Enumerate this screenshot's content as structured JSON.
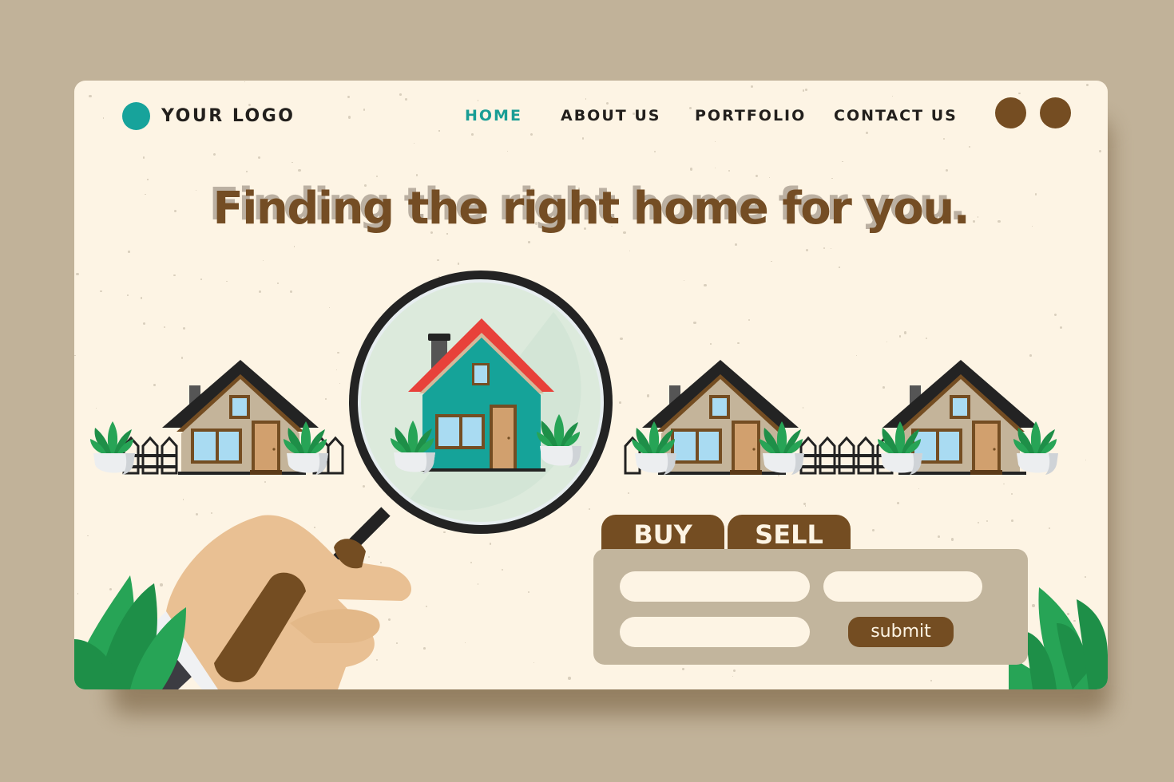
{
  "colors": {
    "background": "#c1b299",
    "page": "#fdf4e4",
    "brand_teal": "#17a39b",
    "nav_active": "#199d95",
    "brown": "#744d22",
    "headline_shadow": "#bbb0a2",
    "panel": "#c2b59d",
    "house_wall": "#c4b49a",
    "house_roof": "#232323",
    "featured_wall": "#15a399",
    "featured_roof": "#e8413a",
    "plant_green": "#27a456",
    "skin": "#e9c093"
  },
  "header": {
    "logo_text": "YOUR LOGO",
    "nav": [
      {
        "label": "HOME",
        "active": true
      },
      {
        "label": "ABOUT US",
        "active": false
      },
      {
        "label": "PORTFOLIO",
        "active": false
      },
      {
        "label": "CONTACT US",
        "active": false
      }
    ],
    "header_buttons": [
      "circle-button",
      "circle-button"
    ]
  },
  "hero": {
    "headline": "Finding the right home for you."
  },
  "search": {
    "tabs": [
      {
        "label": "BUY"
      },
      {
        "label": "SELL"
      }
    ],
    "fields": [
      {
        "value": "",
        "placeholder": ""
      },
      {
        "value": "",
        "placeholder": ""
      },
      {
        "value": "",
        "placeholder": ""
      }
    ],
    "submit_label": "submit"
  },
  "illustration": {
    "houses": [
      "house",
      "featured-house-in-magnifier",
      "house",
      "house"
    ],
    "icons": [
      "magnifying-glass-icon",
      "hand-icon",
      "plant-icon",
      "fence-icon"
    ]
  }
}
